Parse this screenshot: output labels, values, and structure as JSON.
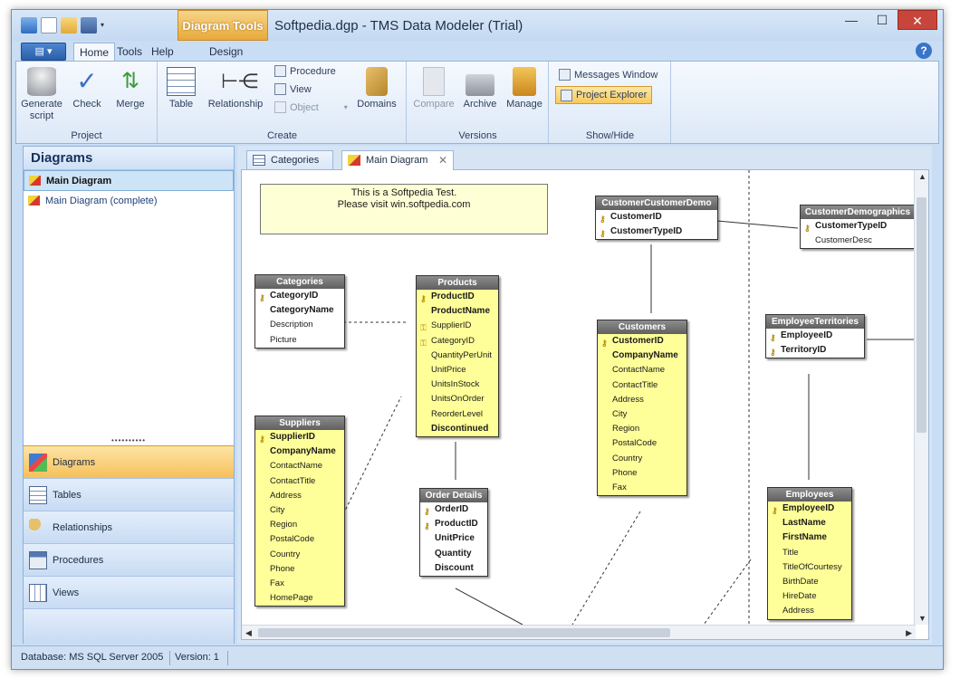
{
  "window": {
    "title": "Softpedia.dgp - TMS Data Modeler (Trial)",
    "context_tab": "Diagram Tools",
    "minimize": "—",
    "maximize": "☐",
    "close": "✕"
  },
  "ribbon_tabs": [
    "Home",
    "Tools",
    "Help",
    "Design"
  ],
  "ribbon": {
    "project": {
      "label": "Project",
      "buttons": [
        "Generate script",
        "Check",
        "Merge"
      ]
    },
    "create": {
      "label": "Create",
      "table": "Table",
      "relationship": "Relationship",
      "procedure": "Procedure",
      "view": "View",
      "object": "Object",
      "domains": "Domains"
    },
    "versions": {
      "label": "Versions",
      "buttons": [
        "Compare",
        "Archive",
        "Manage"
      ]
    },
    "showhide": {
      "label": "Show/Hide",
      "messages": "Messages Window",
      "explorer": "Project Explorer"
    }
  },
  "sidebar": {
    "title": "Diagrams",
    "items": [
      "Main Diagram",
      "Main Diagram (complete)"
    ],
    "nav": [
      "Diagrams",
      "Tables",
      "Relationships",
      "Procedures",
      "Views"
    ]
  },
  "doc_tabs": [
    "Categories",
    "Main Diagram"
  ],
  "note": {
    "line1": "This is a Softpedia Test.",
    "line2": "Please visit win.softpedia.com"
  },
  "entities": [
    {
      "name": "Categories",
      "yellow": false,
      "fields": [
        [
          "CategoryID",
          "pk"
        ],
        [
          "CategoryName",
          "b"
        ],
        [
          "Description",
          ""
        ],
        [
          "Picture",
          ""
        ]
      ]
    },
    {
      "name": "Products",
      "yellow": true,
      "fields": [
        [
          "ProductID",
          "pk"
        ],
        [
          "ProductName",
          "b"
        ],
        [
          "SupplierID",
          "fk"
        ],
        [
          "CategoryID",
          "fk"
        ],
        [
          "QuantityPerUnit",
          ""
        ],
        [
          "UnitPrice",
          ""
        ],
        [
          "UnitsInStock",
          ""
        ],
        [
          "UnitsOnOrder",
          ""
        ],
        [
          "ReorderLevel",
          ""
        ],
        [
          "Discontinued",
          "b"
        ]
      ]
    },
    {
      "name": "Suppliers",
      "yellow": true,
      "fields": [
        [
          "SupplierID",
          "pk"
        ],
        [
          "CompanyName",
          "b"
        ],
        [
          "ContactName",
          ""
        ],
        [
          "ContactTitle",
          ""
        ],
        [
          "Address",
          ""
        ],
        [
          "City",
          ""
        ],
        [
          "Region",
          ""
        ],
        [
          "PostalCode",
          ""
        ],
        [
          "Country",
          ""
        ],
        [
          "Phone",
          ""
        ],
        [
          "Fax",
          ""
        ],
        [
          "HomePage",
          ""
        ]
      ]
    },
    {
      "name": "Order Details",
      "yellow": false,
      "fields": [
        [
          "OrderID",
          "pk"
        ],
        [
          "ProductID",
          "pk"
        ],
        [
          "UnitPrice",
          "b"
        ],
        [
          "Quantity",
          "b"
        ],
        [
          "Discount",
          "b"
        ]
      ]
    },
    {
      "name": "CustomerCustomerDemo",
      "yellow": false,
      "fields": [
        [
          "CustomerID",
          "pk"
        ],
        [
          "CustomerTypeID",
          "pk"
        ]
      ]
    },
    {
      "name": "Customers",
      "yellow": true,
      "fields": [
        [
          "CustomerID",
          "pk"
        ],
        [
          "CompanyName",
          "b"
        ],
        [
          "ContactName",
          ""
        ],
        [
          "ContactTitle",
          ""
        ],
        [
          "Address",
          ""
        ],
        [
          "City",
          ""
        ],
        [
          "Region",
          ""
        ],
        [
          "PostalCode",
          ""
        ],
        [
          "Country",
          ""
        ],
        [
          "Phone",
          ""
        ],
        [
          "Fax",
          ""
        ]
      ]
    },
    {
      "name": "CustomerDemographics",
      "yellow": false,
      "fields": [
        [
          "CustomerTypeID",
          "pk"
        ],
        [
          "CustomerDesc",
          ""
        ]
      ]
    },
    {
      "name": "EmployeeTerritories",
      "yellow": false,
      "fields": [
        [
          "EmployeeID",
          "pk"
        ],
        [
          "TerritoryID",
          "pk"
        ]
      ]
    },
    {
      "name": "Employees",
      "yellow": true,
      "fields": [
        [
          "EmployeeID",
          "pk"
        ],
        [
          "LastName",
          "b"
        ],
        [
          "FirstName",
          "b"
        ],
        [
          "Title",
          ""
        ],
        [
          "TitleOfCourtesy",
          ""
        ],
        [
          "BirthDate",
          ""
        ],
        [
          "HireDate",
          ""
        ],
        [
          "Address",
          ""
        ]
      ]
    }
  ],
  "status": {
    "database": "Database: MS SQL Server 2005",
    "version": "Version: 1"
  },
  "icons": {
    "key": "key-icon",
    "fk": "foreign-key-icon"
  }
}
